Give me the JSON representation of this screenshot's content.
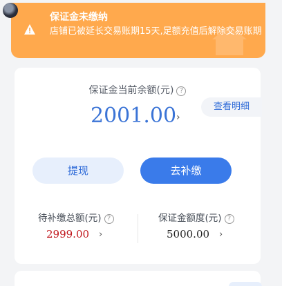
{
  "notice": {
    "title": "保证金未缴纳",
    "message": "店铺已被延长交易账期15天,足额充值后解除交易账期"
  },
  "balance_card": {
    "label": "保证金当前余额(元)",
    "amount": "2001.00",
    "details_label": "查看明细",
    "withdraw_label": "提现",
    "pay_label": "去补缴"
  },
  "stats": {
    "pending_label": "待补缴总额(元)",
    "pending_value": "2999.00",
    "quota_label": "保证金额度(元)",
    "quota_value": "5000.00"
  },
  "colors": {
    "notice_bg": "#ffa94d",
    "primary": "#3a7bea",
    "balance_text": "#3b74d6",
    "pending_text": "#c0151b",
    "quota_text": "#222222"
  },
  "icons": {
    "warning": "warning-triangle-icon",
    "help": "question-circle-icon",
    "chevron": "chevron-right-icon"
  }
}
